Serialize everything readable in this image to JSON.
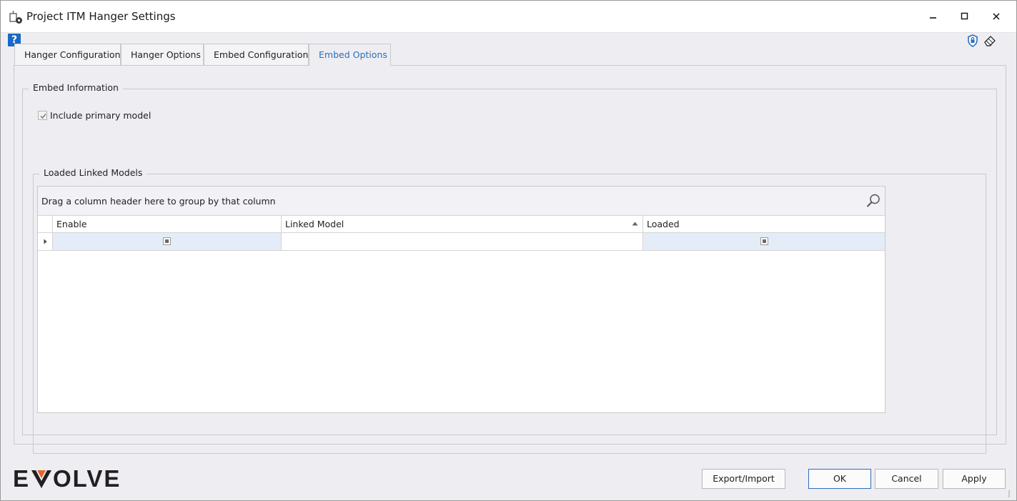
{
  "window": {
    "title": "Project ITM Hanger Settings"
  },
  "tabs": [
    {
      "label": "Hanger Configuration",
      "active": false
    },
    {
      "label": "Hanger Options",
      "active": false
    },
    {
      "label": "Embed Configuration",
      "active": false
    },
    {
      "label": "Embed Options",
      "active": true
    }
  ],
  "help": {
    "glyph": "?"
  },
  "embed_info": {
    "title": "Embed Information",
    "include_primary": {
      "label": "Include primary model",
      "checked": true
    }
  },
  "linked_models": {
    "title": "Loaded Linked Models",
    "group_panel_text": "Drag a column header here to group by that column",
    "columns": [
      "Enable",
      "Linked Model",
      "Loaded"
    ],
    "sort_column": "Linked Model",
    "sort_direction": "ascending",
    "rows": [
      {
        "enable": "indeterminate",
        "linked_model": "",
        "loaded": "indeterminate"
      }
    ]
  },
  "logo": {
    "text_left": "E",
    "text_right": "OLVE",
    "accent_color": "#e8622a"
  },
  "buttons": {
    "export_import": "Export/Import",
    "ok": "OK",
    "cancel": "Cancel",
    "apply": "Apply"
  },
  "colors": {
    "accent_blue": "#2a6fbd",
    "selected_cell": "#e4ecf7",
    "background": "#eeedf2"
  },
  "icons": [
    "app-settings-icon",
    "minimize-icon",
    "maximize-icon",
    "close-icon",
    "help-icon",
    "shield-icon",
    "eraser-icon",
    "search-icon",
    "sort-ascending-icon",
    "row-indicator-icon",
    "size-grip-icon"
  ]
}
